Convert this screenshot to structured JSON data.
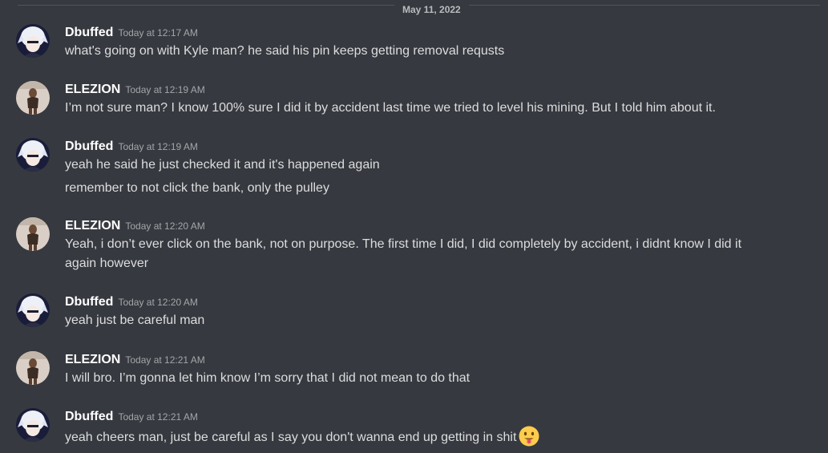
{
  "date_divider": "May 11, 2022",
  "messages": [
    {
      "author": "Dbuffed",
      "time": "Today at 12:17 AM",
      "lines": [
        "what's going on with Kyle man? he said his pin keeps getting removal requsts"
      ]
    },
    {
      "author": "ELEZION",
      "time": "Today at 12:19 AM",
      "lines": [
        "I’m not sure man? I know 100% sure I did it by accident last time we tried to level his mining. But I told him about it."
      ]
    },
    {
      "author": "Dbuffed",
      "time": "Today at 12:19 AM",
      "lines": [
        "yeah he said he just checked it and it's happened again",
        "remember to not click the bank, only the pulley"
      ]
    },
    {
      "author": "ELEZION",
      "time": "Today at 12:20 AM",
      "lines": [
        "Yeah, i don’t ever click on the bank, not on purpose. The first time I did, I did completely by accident, i didnt know I did it",
        "again however"
      ]
    },
    {
      "author": "Dbuffed",
      "time": "Today at 12:20 AM",
      "lines": [
        "yeah just be careful man"
      ]
    },
    {
      "author": "ELEZION",
      "time": "Today at 12:21 AM",
      "lines": [
        "I will bro. I’m gonna let him know I’m sorry that I did not mean to do that"
      ]
    },
    {
      "author": "Dbuffed",
      "time": "Today at 12:21 AM",
      "lines": [
        "yeah cheers man, just be careful as I say you don't wanna end up getting in shit"
      ],
      "emoji": "tongue-out-emoji"
    }
  ],
  "colors": {
    "background": "#36393f",
    "author": "#ffffff",
    "timestamp": "#a3a6aa",
    "text": "#dcddde",
    "divider": "#4f545c"
  }
}
